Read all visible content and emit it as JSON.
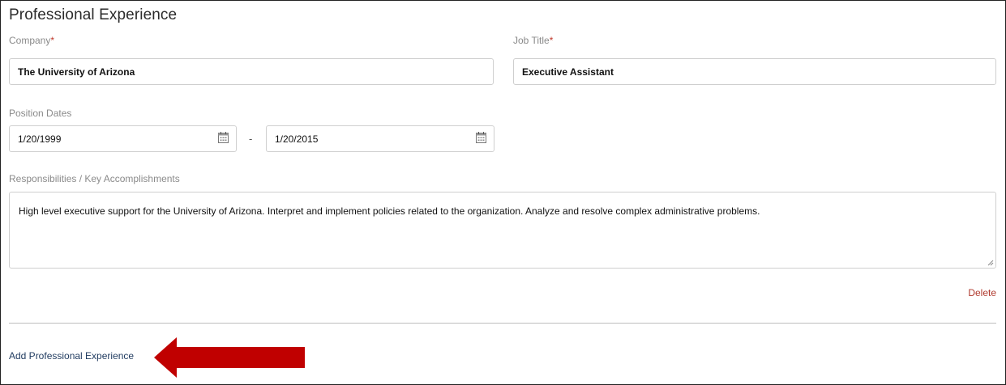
{
  "section": {
    "title": "Professional Experience"
  },
  "company": {
    "label": "Company",
    "required_mark": "*",
    "value": "The University of Arizona"
  },
  "job_title": {
    "label": "Job Title",
    "required_mark": "*",
    "value": "Executive Assistant"
  },
  "position_dates": {
    "label": "Position Dates",
    "start": "1/20/1999",
    "separator": "-",
    "end": "1/20/2015"
  },
  "responsibilities": {
    "label": "Responsibilities / Key Accomplishments",
    "value": "High level executive support for the University of Arizona. Interpret and implement policies related to the organization. Analyze and resolve complex administrative problems."
  },
  "actions": {
    "delete_label": "Delete",
    "add_label": "Add Professional Experience"
  },
  "colors": {
    "required": "#c0392b",
    "delete": "#b03a2e",
    "link": "#1f3a5f",
    "arrow": "#c00000"
  },
  "icons": {
    "date_picker": "calendar-icon",
    "pointer": "arrow-left-icon"
  }
}
